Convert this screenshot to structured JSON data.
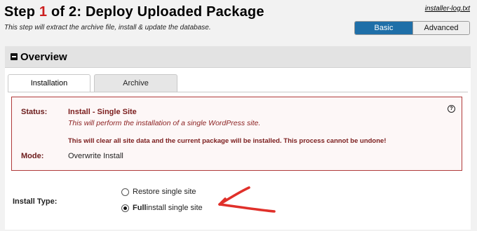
{
  "header": {
    "title_prefix": "Step ",
    "step_number": "1",
    "title_suffix": " of 2: Deploy Uploaded Package",
    "subtitle": "This step will extract the archive file, install & update the database.",
    "log_link": "installer-log.txt",
    "mode_toggle": {
      "basic": "Basic",
      "advanced": "Advanced",
      "selected": "Basic"
    }
  },
  "overview": {
    "title": "Overview",
    "tabs": [
      {
        "label": "Installation",
        "active": true
      },
      {
        "label": "Archive",
        "active": false
      }
    ],
    "status": {
      "status_label": "Status:",
      "status_value": "Install - Single Site",
      "status_description": "This will perform the installation of a single WordPress site.",
      "warning": "This will clear all site data and the current package will be installed. This process cannot be undone!",
      "mode_label": "Mode:",
      "mode_value": "Overwrite Install"
    },
    "install_type": {
      "label": "Install Type:",
      "options": [
        {
          "text": "Restore single site",
          "checked": false
        },
        {
          "bold": "Full",
          "text": " install single site",
          "checked": true
        }
      ]
    }
  },
  "colors": {
    "step_number": "#cc1f1f",
    "basic_button": "#1f6fa8",
    "status_border": "#b03a3a",
    "annotation_arrow": "#e0302a"
  },
  "icons": {
    "collapse": "minus-square-icon",
    "help": "question-circle-icon",
    "annotation": "hand-drawn-arrow-icon"
  }
}
